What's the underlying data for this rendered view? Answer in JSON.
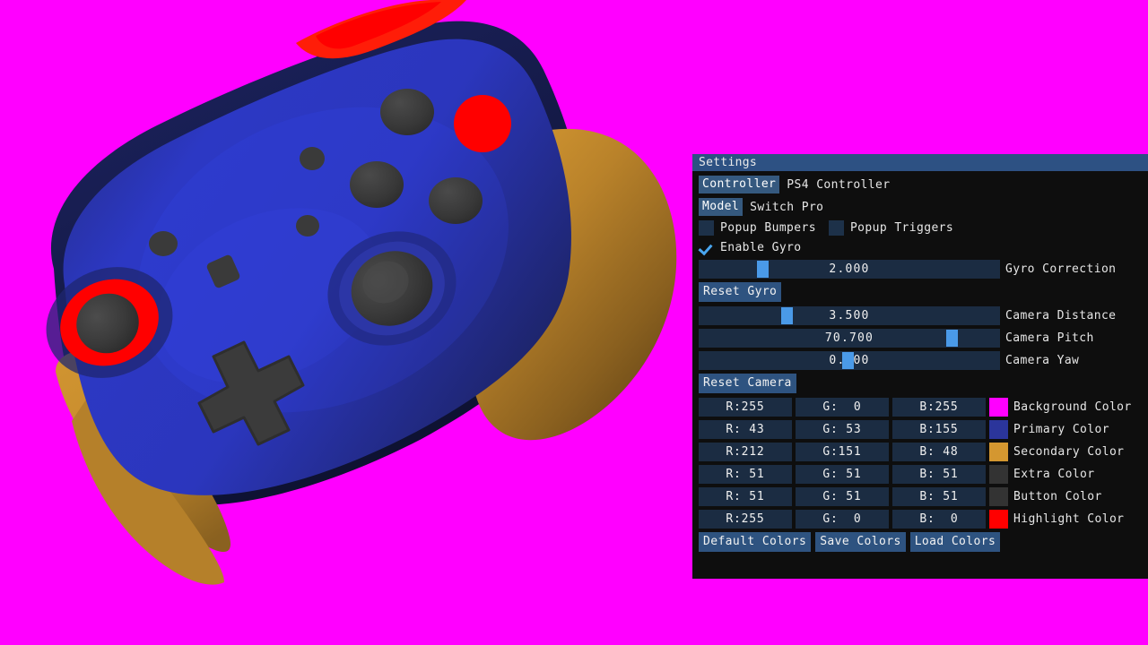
{
  "viewport": {
    "background_color": "#ff00ff",
    "model_name": "Switch Pro",
    "model_colors": {
      "primary": "#2b359b",
      "secondary": "#d49730",
      "extra": "#333333",
      "button": "#333333",
      "highlight": "#ff0000"
    }
  },
  "panel": {
    "title": "Settings",
    "title_bg": "#2d5183",
    "controller": {
      "button_label": "Controller",
      "value": "PS4 Controller"
    },
    "model": {
      "button_label": "Model",
      "value": "Switch Pro"
    },
    "checkboxes": [
      {
        "label": "Popup Bumpers",
        "checked": false
      },
      {
        "label": "Popup Triggers",
        "checked": false
      },
      {
        "label": "Enable Gyro",
        "checked": true
      }
    ],
    "sliders": [
      {
        "label": "Gyro Correction",
        "value": "2.000",
        "percent": 20.0
      },
      {
        "label": "Camera Distance",
        "value": "3.500",
        "percent": 28.5
      },
      {
        "label": "Camera Pitch",
        "value": "70.700",
        "percent": 85.5
      },
      {
        "label": "Camera Yaw",
        "value": "0.100",
        "percent": 49.5
      }
    ],
    "reset_gyro_label": "Reset Gyro",
    "reset_camera_label": "Reset Camera",
    "colors": [
      {
        "r": "R:255",
        "g": "G:  0",
        "b": "B:255",
        "swatch": "#ff00ff",
        "label": "Background Color"
      },
      {
        "r": "R: 43",
        "g": "G: 53",
        "b": "B:155",
        "swatch": "#2b359b",
        "label": "Primary Color"
      },
      {
        "r": "R:212",
        "g": "G:151",
        "b": "B: 48",
        "swatch": "#d49730",
        "label": "Secondary Color"
      },
      {
        "r": "R: 51",
        "g": "G: 51",
        "b": "B: 51",
        "swatch": "#333333",
        "label": "Extra Color"
      },
      {
        "r": "R: 51",
        "g": "G: 51",
        "b": "B: 51",
        "swatch": "#333333",
        "label": "Button Color"
      },
      {
        "r": "R:255",
        "g": "G:  0",
        "b": "B:  0",
        "swatch": "#ff0000",
        "label": "Highlight Color"
      }
    ],
    "footer_buttons": [
      {
        "label": "Default Colors"
      },
      {
        "label": "Save Colors"
      },
      {
        "label": "Load Colors"
      }
    ]
  }
}
